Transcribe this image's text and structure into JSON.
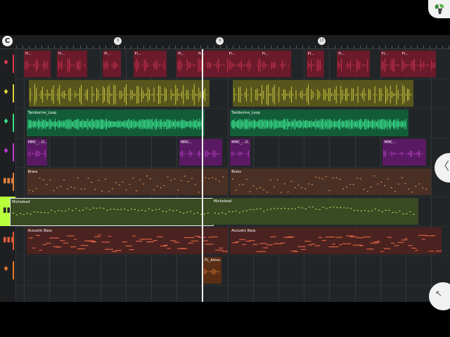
{
  "ruler": {
    "magnet_label": "C",
    "bar_markers": [
      {
        "label": "5",
        "bar": 5
      },
      {
        "label": "9",
        "bar": 9
      },
      {
        "label": "13",
        "bar": 13
      }
    ]
  },
  "icons": {
    "magnet": "magnet-snap-icon",
    "logo": "fl-studio-logo-icon",
    "side": "chevron-left-icon",
    "corner": "arrow-up-left-icon"
  },
  "side_button_glyph": "〈",
  "corner_button_glyph": "↖",
  "tracks": [
    {
      "name": "track-hihat",
      "icon": "drum-icon",
      "glyph": "♦",
      "color": "#e23a59"
    },
    {
      "name": "track-shaker",
      "icon": "drum-icon",
      "glyph": "♦",
      "color": "#d8d63c"
    },
    {
      "name": "track-tambourine",
      "icon": "drum-icon",
      "glyph": "♦",
      "color": "#39e08b"
    },
    {
      "name": "track-mmc",
      "icon": "drum-icon",
      "glyph": "♦",
      "color": "#c23ad3"
    },
    {
      "name": "track-brass",
      "icon": "piano-keys-icon",
      "glyph": "▮▮▮",
      "color": "#e0823a"
    },
    {
      "name": "track-michelead",
      "icon": "piano-keys-icon",
      "glyph": "▮▮▮",
      "color": "#b8ff3c"
    },
    {
      "name": "track-acoustic-bass",
      "icon": "piano-keys-icon",
      "glyph": "▮▮▮",
      "color": "#e25a3a"
    },
    {
      "name": "track-fl-atmo",
      "icon": "drum-icon",
      "glyph": "♦",
      "color": "#e87a2a"
    }
  ],
  "clips": [
    {
      "track": 0,
      "type": "audio",
      "label": "Fl...",
      "color": "#e23a59",
      "bg": "#6a1a2a",
      "start_bar": 1,
      "len_bars": 1.05
    },
    {
      "track": 0,
      "type": "audio",
      "label": "Fl...",
      "color": "#e23a59",
      "bg": "#6a1a2a",
      "start_bar": 2.3,
      "len_bars": 1.2
    },
    {
      "track": 0,
      "type": "audio",
      "label": "Fl...",
      "color": "#e23a59",
      "bg": "#6a1a2a",
      "start_bar": 4.1,
      "len_bars": 0.7
    },
    {
      "track": 0,
      "type": "audio",
      "label": "Fl...",
      "color": "#e23a59",
      "bg": "#6a1a2a",
      "start_bar": 5.3,
      "len_bars": 1.3
    },
    {
      "track": 0,
      "type": "audio",
      "label": "Fl...",
      "color": "#e23a59",
      "bg": "#6a1a2a",
      "start_bar": 7.0,
      "len_bars": 0.8
    },
    {
      "track": 0,
      "type": "audio",
      "label": "Fl...",
      "color": "#e23a59",
      "bg": "#6a1a2a",
      "start_bar": 7.8,
      "len_bars": 1.4
    },
    {
      "track": 0,
      "type": "audio",
      "label": "Fl...",
      "color": "#e23a59",
      "bg": "#6a1a2a",
      "start_bar": 9.0,
      "len_bars": 1.35
    },
    {
      "track": 0,
      "type": "audio",
      "label": "Fl...",
      "color": "#e23a59",
      "bg": "#6a1a2a",
      "start_bar": 10.3,
      "len_bars": 1.2
    },
    {
      "track": 0,
      "type": "audio",
      "label": "Fl...",
      "color": "#e23a59",
      "bg": "#6a1a2a",
      "start_bar": 12.1,
      "len_bars": 0.7
    },
    {
      "track": 0,
      "type": "audio",
      "label": "Fl...",
      "color": "#e23a59",
      "bg": "#6a1a2a",
      "start_bar": 13.3,
      "len_bars": 1.3
    },
    {
      "track": 0,
      "type": "audio",
      "label": "Fl...",
      "color": "#e23a59",
      "bg": "#6a1a2a",
      "start_bar": 15.0,
      "len_bars": 0.8
    },
    {
      "track": 0,
      "type": "audio",
      "label": "Fl...",
      "color": "#e23a59",
      "bg": "#6a1a2a",
      "start_bar": 15.8,
      "len_bars": 1.4
    },
    {
      "track": 1,
      "type": "audio",
      "label": "",
      "color": "#e6e04a",
      "bg": "#57561c",
      "start_bar": 1.2,
      "len_bars": 7.1
    },
    {
      "track": 1,
      "type": "audio",
      "label": "",
      "color": "#e6e04a",
      "bg": "#57561c",
      "start_bar": 9.2,
      "len_bars": 7.1
    },
    {
      "track": 2,
      "type": "audio",
      "label": "Tamborine_Loop",
      "color": "#39e08b",
      "bg": "#135c3a",
      "start_bar": 1.1,
      "len_bars": 7.0
    },
    {
      "track": 2,
      "type": "audio",
      "label": "Tamborine_Loop",
      "color": "#39e08b",
      "bg": "#135c3a",
      "start_bar": 9.1,
      "len_bars": 7.0
    },
    {
      "track": 3,
      "type": "audio",
      "label": "MMC_...O...",
      "color": "#d04ae0",
      "bg": "#5a1a63",
      "start_bar": 1.1,
      "len_bars": 0.8
    },
    {
      "track": 3,
      "type": "audio",
      "label": "MMC...",
      "color": "#d04ae0",
      "bg": "#5a1a63",
      "start_bar": 7.1,
      "len_bars": 1.7
    },
    {
      "track": 3,
      "type": "audio",
      "label": "MMC_...O...",
      "color": "#d04ae0",
      "bg": "#5a1a63",
      "start_bar": 9.1,
      "len_bars": 0.8
    },
    {
      "track": 3,
      "type": "audio",
      "label": "MMC...",
      "color": "#d04ae0",
      "bg": "#5a1a63",
      "start_bar": 15.1,
      "len_bars": 1.7
    },
    {
      "track": 4,
      "type": "pattern",
      "label": "Brass",
      "color": "#f0a060",
      "bg": "#4a2f24",
      "start_bar": 1.1,
      "len_bars": 7.9
    },
    {
      "track": 4,
      "type": "pattern",
      "label": "Brass",
      "color": "#f0a060",
      "bg": "#4a2f24",
      "start_bar": 9.1,
      "len_bars": 7.9
    },
    {
      "track": 5,
      "type": "pattern",
      "label": "Michelead",
      "color": "#c8f070",
      "bg": "#3a4a22",
      "start_bar": 0.45,
      "len_bars": 7.95,
      "selected": true
    },
    {
      "track": 5,
      "type": "pattern",
      "label": "Michelead",
      "color": "#c8f070",
      "bg": "#3a4a22",
      "start_bar": 8.4,
      "len_bars": 8.1
    },
    {
      "track": 6,
      "type": "pattern",
      "label": "Acoustic Bass",
      "color": "#f06a4a",
      "bg": "#4a2320",
      "start_bar": 1.1,
      "len_bars": 7.9
    },
    {
      "track": 6,
      "type": "pattern",
      "label": "Acoustic Bass",
      "color": "#f06a4a",
      "bg": "#4a2320",
      "start_bar": 9.1,
      "len_bars": 8.3
    },
    {
      "track": 7,
      "type": "audio",
      "label": "FL_Atmo...",
      "color": "#f08a3a",
      "bg": "#5a2e14",
      "start_bar": 8.05,
      "len_bars": 0.7
    }
  ],
  "playhead_bar": 8.0
}
